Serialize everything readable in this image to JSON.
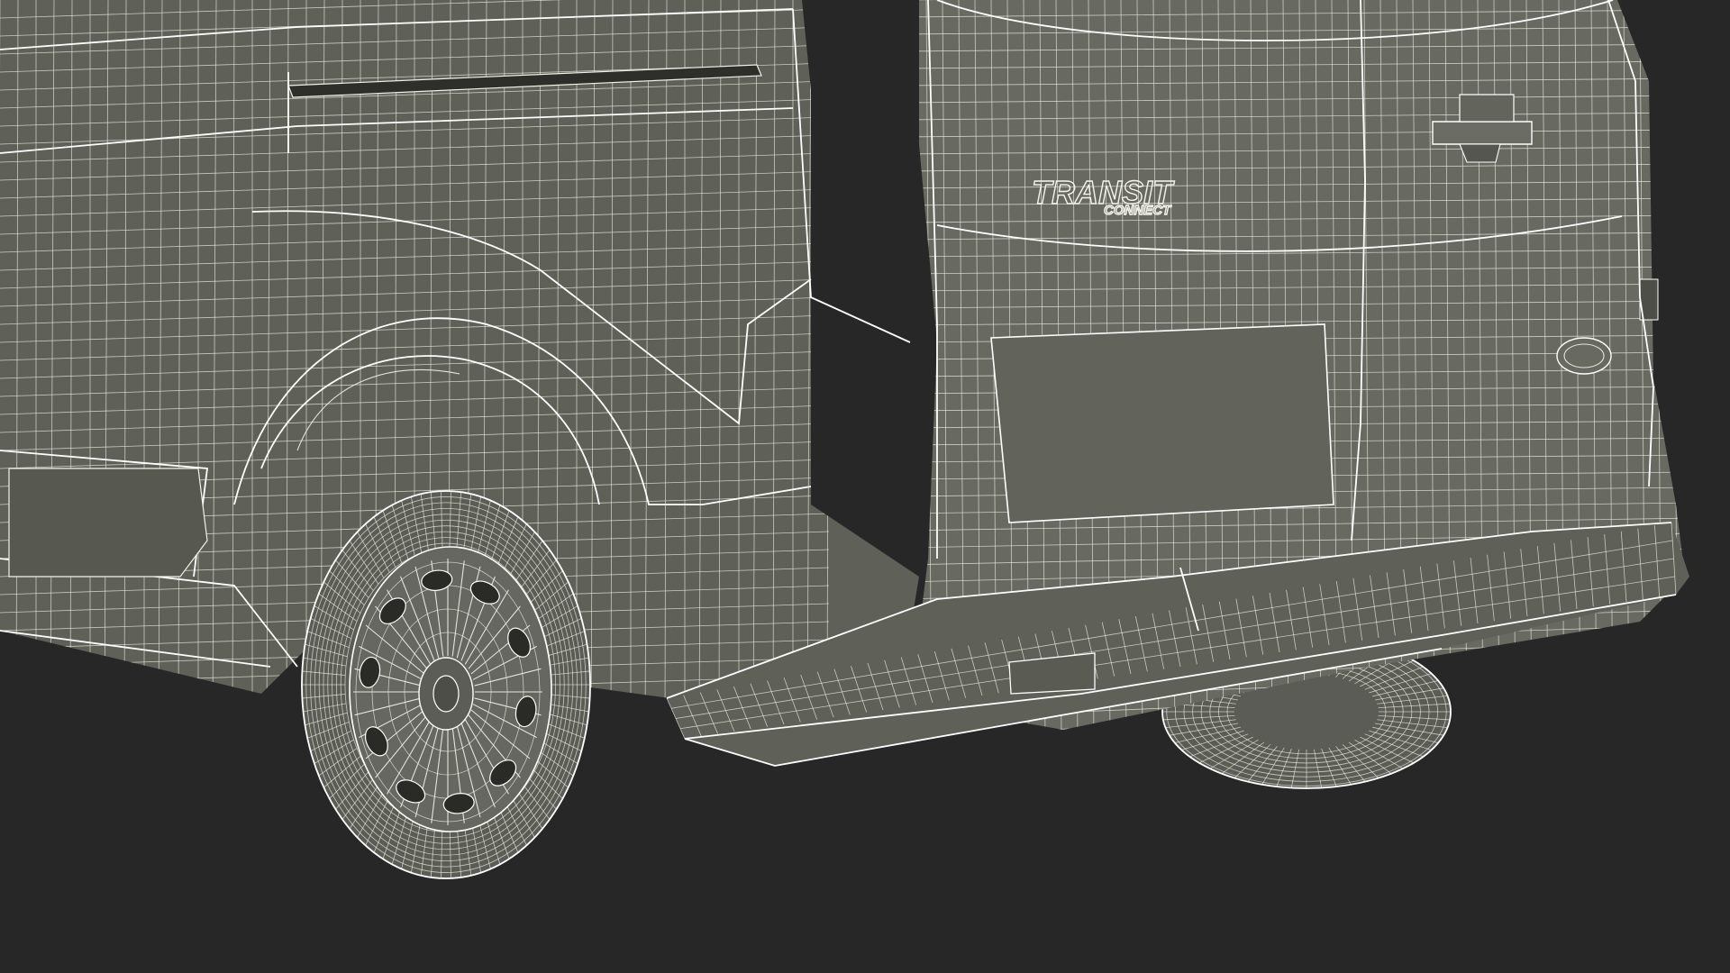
{
  "scene": {
    "background_color": "#272727",
    "body_color": "#5f6058",
    "wire_color": "#f2f2ea"
  },
  "badge": {
    "line1": "TRANSIT",
    "line2": "CONNECT"
  }
}
